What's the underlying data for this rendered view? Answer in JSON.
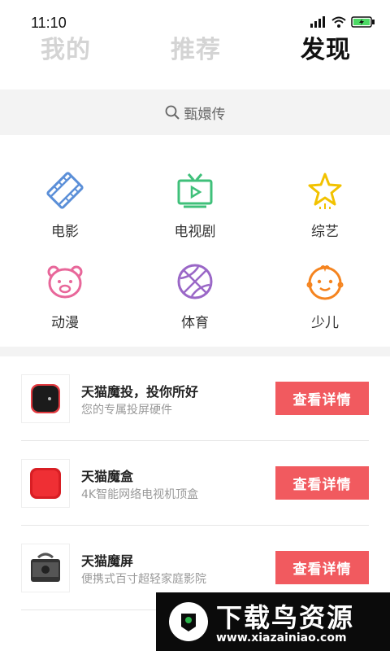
{
  "status_bar": {
    "time": "11:10"
  },
  "tabs": [
    {
      "label": "我的",
      "active": false
    },
    {
      "label": "推荐",
      "active": false
    },
    {
      "label": "发现",
      "active": true
    }
  ],
  "search": {
    "placeholder": "甄嬛传"
  },
  "categories": [
    {
      "label": "电影",
      "icon": "film-icon",
      "color": "#5b8fd8"
    },
    {
      "label": "电视剧",
      "icon": "tv-icon",
      "color": "#3fc07a"
    },
    {
      "label": "综艺",
      "icon": "star-icon",
      "color": "#f2c200"
    },
    {
      "label": "动漫",
      "icon": "bear-icon",
      "color": "#e8679a"
    },
    {
      "label": "体育",
      "icon": "basketball-icon",
      "color": "#9a67c7"
    },
    {
      "label": "少儿",
      "icon": "child-face-icon",
      "color": "#f5841f"
    }
  ],
  "products": [
    {
      "title": "天猫魔投，投你所好",
      "subtitle": "您的专属投屏硬件",
      "button": "查看详情"
    },
    {
      "title": "天猫魔盒",
      "subtitle": "4K智能网络电视机顶盒",
      "button": "查看详情"
    },
    {
      "title": "天猫魔屏",
      "subtitle": "便携式百寸超轻家庭影院",
      "button": "查看详情"
    }
  ],
  "watermark": {
    "text": "下载鸟资源",
    "url": "www.xiazainiao.com"
  },
  "colors": {
    "accent": "#f15a5f",
    "search_bg": "#f3f3f3"
  }
}
